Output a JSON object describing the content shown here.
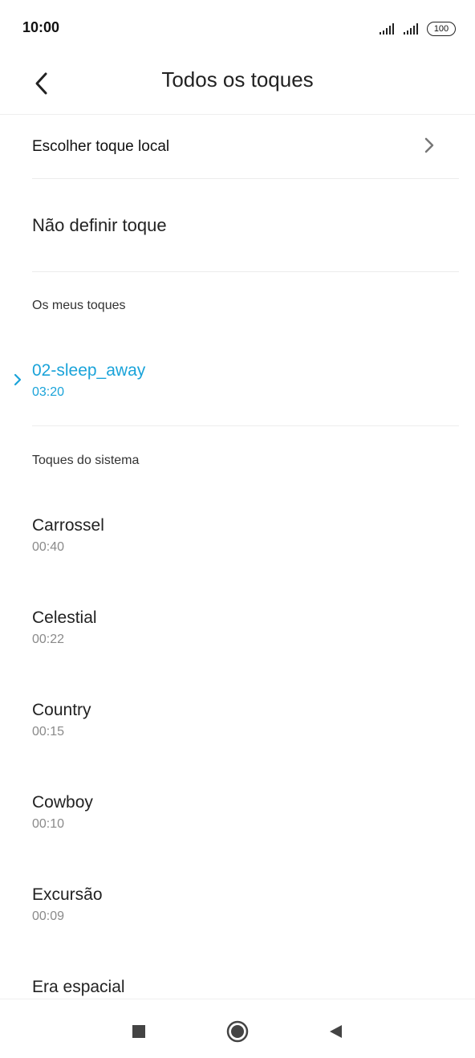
{
  "status": {
    "time": "10:00",
    "battery": "100"
  },
  "header": {
    "title": "Todos os toques"
  },
  "menu": {
    "local_label": "Escolher toque local",
    "none_label": "Não definir toque"
  },
  "my_tones": {
    "heading": "Os meus toques",
    "items": [
      {
        "name": "02-sleep_away",
        "duration": "03:20"
      }
    ]
  },
  "system_tones": {
    "heading": "Toques do sistema",
    "items": [
      {
        "name": "Carrossel",
        "duration": "00:40"
      },
      {
        "name": "Celestial",
        "duration": "00:22"
      },
      {
        "name": "Country",
        "duration": "00:15"
      },
      {
        "name": "Cowboy",
        "duration": "00:10"
      },
      {
        "name": "Excursão",
        "duration": "00:09"
      },
      {
        "name": "Era espacial",
        "duration": ""
      }
    ]
  },
  "colors": {
    "accent": "#1aa3d9",
    "text": "#222222",
    "secondary": "#8a8a8a"
  },
  "icons": {
    "back": "back-arrow-icon",
    "chevron": "chevron-right-icon",
    "nav_recents": "square-icon",
    "nav_home": "circle-icon",
    "nav_back": "triangle-back-icon"
  }
}
